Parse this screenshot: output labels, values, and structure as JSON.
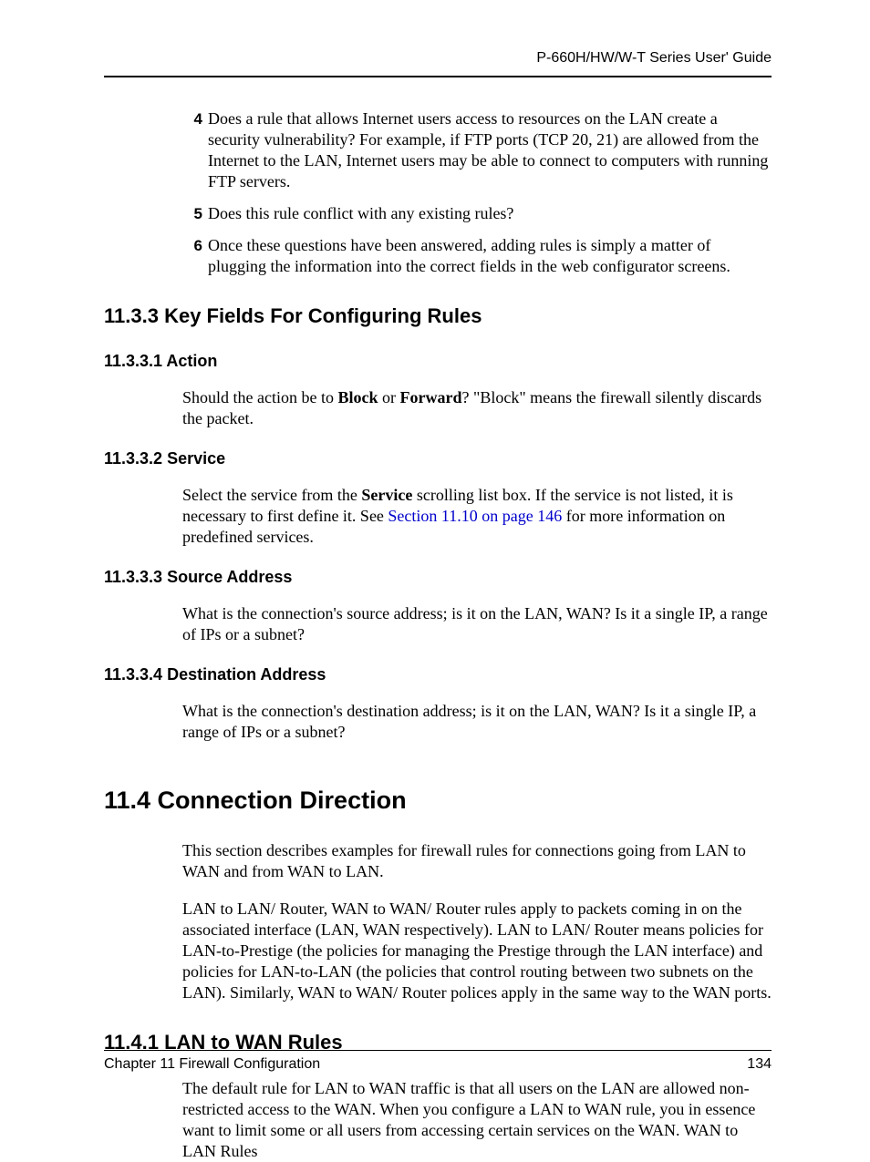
{
  "header": {
    "running": "P-660H/HW/W-T Series User' Guide"
  },
  "list": {
    "items": [
      {
        "num": "4",
        "text": "Does a rule that allows Internet users access to resources on the LAN create a security vulnerability? For example, if FTP ports (TCP 20, 21) are allowed from the Internet to the LAN, Internet users may be able to connect to computers with running FTP servers."
      },
      {
        "num": "5",
        "text": "Does this rule conflict with any existing rules?"
      },
      {
        "num": "6",
        "text": "Once these questions have been answered, adding rules is simply a matter of plugging the information into the correct fields in the web configurator screens."
      }
    ]
  },
  "sec_11_3_3": {
    "title": "11.3.3  Key Fields For Configuring Rules",
    "s1": {
      "title": "11.3.3.1  Action",
      "pre": "Should the action be to ",
      "b1": "Block",
      "mid": " or ",
      "b2": "Forward",
      "post": "? \"Block\" means the firewall silently discards the packet."
    },
    "s2": {
      "title": "11.3.3.2  Service",
      "pre": "Select the service from the ",
      "b1": "Service",
      "mid": " scrolling list box. If the service is not listed, it is necessary to first define it. See ",
      "link": "Section 11.10 on page 146",
      "post": " for more information on predefined services."
    },
    "s3": {
      "title": "11.3.3.3  Source Address",
      "text": "What is the connection's source address; is it on the LAN, WAN? Is it a single IP, a range of IPs or a subnet?"
    },
    "s4": {
      "title": "11.3.3.4  Destination Address",
      "text": "What is the connection's destination address; is it on the LAN, WAN? Is it a single IP, a range of IPs or a subnet?"
    }
  },
  "sec_11_4": {
    "title": "11.4  Connection Direction",
    "p1": "This section describes examples for firewall rules for connections going from LAN to WAN and from WAN to LAN.",
    "p2": "LAN to LAN/ Router, WAN to WAN/ Router rules apply to packets coming in on the associated interface (LAN, WAN respectively). LAN to LAN/ Router means policies for LAN-to-Prestige (the policies for managing the Prestige through the LAN interface) and policies for LAN-to-LAN (the policies that control routing between two subnets on the LAN). Similarly, WAN to WAN/ Router polices apply in the same way to the WAN ports.",
    "s1": {
      "title": "11.4.1  LAN to WAN Rules",
      "p1": "The default rule for LAN to WAN traffic is that all users on the LAN are allowed non-restricted access to the WAN. When you configure a LAN to WAN rule, you in essence want to limit some or all users from accessing certain services on the WAN. WAN to LAN Rules"
    }
  },
  "footer": {
    "left": "Chapter 11 Firewall Configuration",
    "right": "134"
  }
}
